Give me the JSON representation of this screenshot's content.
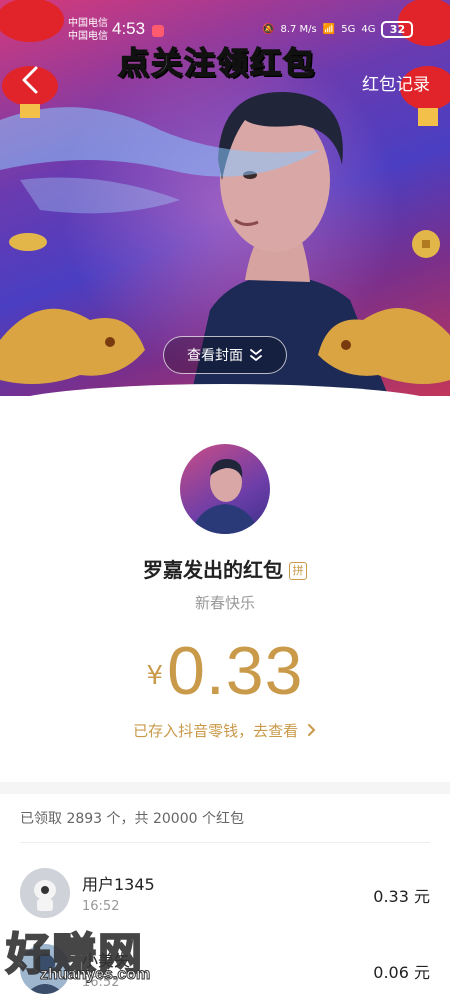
{
  "status_bar": {
    "carrier_1": "中国电信",
    "carrier_2": "中国电信",
    "time": "4:53",
    "net_speed": "8.7 M/s",
    "battery": "32"
  },
  "overlay_title": "点关注领红包",
  "header": {
    "back_icon": "chevron-left-icon",
    "records_label": "红包记录"
  },
  "cover": {
    "view_cover_label": "查看封面",
    "view_cover_icon": "double-chevron-down-icon"
  },
  "packet": {
    "sender": "罗嘉发出的红包",
    "pin_badge": "拼",
    "greeting": "新春快乐",
    "currency": "¥",
    "amount": "0.33",
    "deposit_text": "已存入抖音零钱，去查看",
    "deposit_icon": "chevron-right-icon"
  },
  "claims": {
    "summary": "已领取 2893 个，共 20000 个红包",
    "items": [
      {
        "name": "用户1345",
        "time": "16:52",
        "amount": "0.33 元"
      },
      {
        "name": "小美失",
        "time": "16:52",
        "amount": "0.06 元"
      }
    ]
  },
  "watermark": {
    "text": "好赚网",
    "url": "zhuanyes.com"
  },
  "colors": {
    "gold": "#c99a4a",
    "cover_purple": "#6a3bb0",
    "cover_pink": "#d63a7a"
  }
}
